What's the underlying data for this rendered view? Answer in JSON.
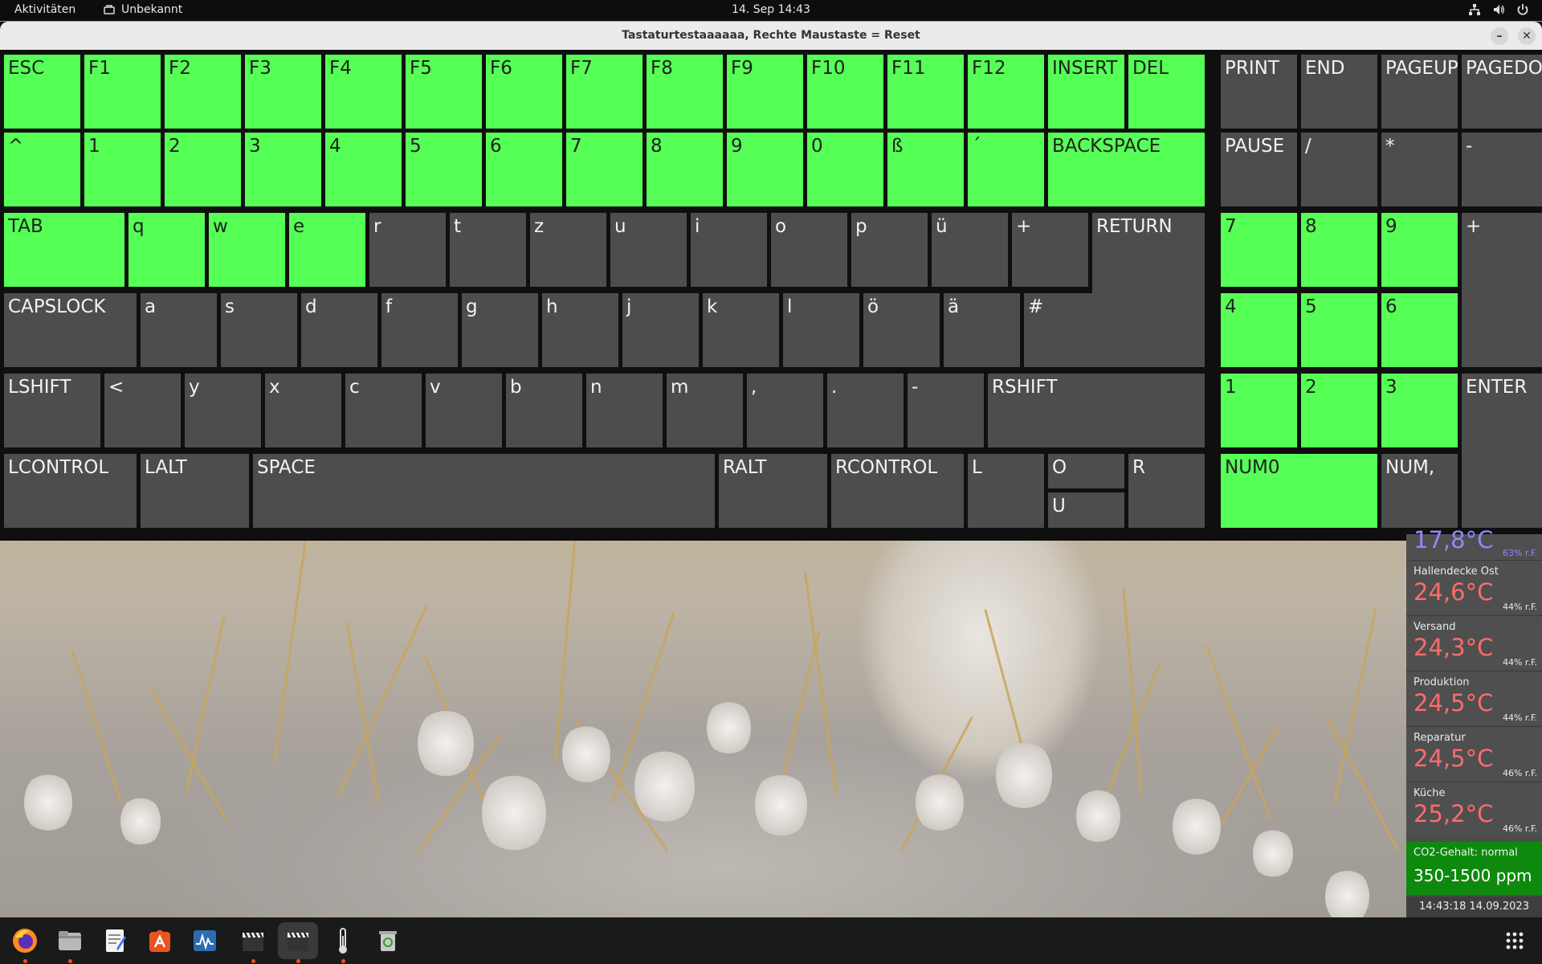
{
  "topbar": {
    "activities": "Aktivitäten",
    "app_name": "Unbekannt",
    "clock": "14. Sep  14:43"
  },
  "window": {
    "title": "Tastaturtestaaaaaa, Rechte Maustaste = Reset"
  },
  "colors": {
    "key_pressed": "#55ff55",
    "key_idle": "#4d4d4d",
    "temperature": "#ff6b6b",
    "co2_ok": "#0d8a0d"
  },
  "keys": {
    "esc": {
      "label": "ESC",
      "pressed": true
    },
    "f1": {
      "label": "F1",
      "pressed": true
    },
    "f2": {
      "label": "F2",
      "pressed": true
    },
    "f3": {
      "label": "F3",
      "pressed": true
    },
    "f4": {
      "label": "F4",
      "pressed": true
    },
    "f5": {
      "label": "F5",
      "pressed": true
    },
    "f6": {
      "label": "F6",
      "pressed": true
    },
    "f7": {
      "label": "F7",
      "pressed": true
    },
    "f8": {
      "label": "F8",
      "pressed": true
    },
    "f9": {
      "label": "F9",
      "pressed": true
    },
    "f10": {
      "label": "F10",
      "pressed": true
    },
    "f11": {
      "label": "F11",
      "pressed": true
    },
    "f12": {
      "label": "F12",
      "pressed": true
    },
    "insert": {
      "label": "INSERT",
      "pressed": true
    },
    "del": {
      "label": "DEL",
      "pressed": true
    },
    "print": {
      "label": "PRINT",
      "pressed": false
    },
    "end": {
      "label": "END",
      "pressed": false
    },
    "pageup": {
      "label": "PAGEUP",
      "pressed": false
    },
    "pagedown": {
      "label": "PAGEDOWN",
      "pressed": false
    },
    "caret": {
      "label": "^",
      "pressed": true
    },
    "d1": {
      "label": "1",
      "pressed": true
    },
    "d2": {
      "label": "2",
      "pressed": true
    },
    "d3": {
      "label": "3",
      "pressed": true
    },
    "d4": {
      "label": "4",
      "pressed": true
    },
    "d5": {
      "label": "5",
      "pressed": true
    },
    "d6": {
      "label": "6",
      "pressed": true
    },
    "d7": {
      "label": "7",
      "pressed": true
    },
    "d8": {
      "label": "8",
      "pressed": true
    },
    "d9": {
      "label": "9",
      "pressed": true
    },
    "d0": {
      "label": "0",
      "pressed": true
    },
    "sz": {
      "label": "ß",
      "pressed": true
    },
    "acute": {
      "label": "´",
      "pressed": true
    },
    "backspace": {
      "label": "BACKSPACE",
      "pressed": true
    },
    "pause": {
      "label": "PAUSE",
      "pressed": false
    },
    "kp_div": {
      "label": "/",
      "pressed": false
    },
    "kp_mul": {
      "label": "*",
      "pressed": false
    },
    "kp_sub": {
      "label": "-",
      "pressed": false
    },
    "tab": {
      "label": "TAB",
      "pressed": true
    },
    "q": {
      "label": "q",
      "pressed": true
    },
    "w": {
      "label": "w",
      "pressed": true
    },
    "e": {
      "label": "e",
      "pressed": true
    },
    "r": {
      "label": "r",
      "pressed": false
    },
    "t": {
      "label": "t",
      "pressed": false
    },
    "z": {
      "label": "z",
      "pressed": false
    },
    "u": {
      "label": "u",
      "pressed": false
    },
    "i": {
      "label": "i",
      "pressed": false
    },
    "o": {
      "label": "o",
      "pressed": false
    },
    "p": {
      "label": "p",
      "pressed": false
    },
    "ue": {
      "label": "ü",
      "pressed": false
    },
    "plus": {
      "label": "+",
      "pressed": false
    },
    "return": {
      "label": "RETURN",
      "pressed": false
    },
    "kp7": {
      "label": "7",
      "pressed": true
    },
    "kp8": {
      "label": "8",
      "pressed": true
    },
    "kp9": {
      "label": "9",
      "pressed": true
    },
    "kp_add": {
      "label": "+",
      "pressed": false
    },
    "capslock": {
      "label": "CAPSLOCK",
      "pressed": false
    },
    "a": {
      "label": "a",
      "pressed": false
    },
    "s": {
      "label": "s",
      "pressed": false
    },
    "d": {
      "label": "d",
      "pressed": false
    },
    "f": {
      "label": "f",
      "pressed": false
    },
    "g": {
      "label": "g",
      "pressed": false
    },
    "h": {
      "label": "h",
      "pressed": false
    },
    "j": {
      "label": "j",
      "pressed": false
    },
    "k": {
      "label": "k",
      "pressed": false
    },
    "l": {
      "label": "l",
      "pressed": false
    },
    "oe": {
      "label": "ö",
      "pressed": false
    },
    "ae": {
      "label": "ä",
      "pressed": false
    },
    "hash": {
      "label": "#",
      "pressed": false
    },
    "kp4": {
      "label": "4",
      "pressed": true
    },
    "kp5": {
      "label": "5",
      "pressed": true
    },
    "kp6": {
      "label": "6",
      "pressed": true
    },
    "lshift": {
      "label": "LSHIFT",
      "pressed": false
    },
    "less": {
      "label": "<",
      "pressed": false
    },
    "y": {
      "label": "y",
      "pressed": false
    },
    "x": {
      "label": "x",
      "pressed": false
    },
    "c": {
      "label": "c",
      "pressed": false
    },
    "v": {
      "label": "v",
      "pressed": false
    },
    "b": {
      "label": "b",
      "pressed": false
    },
    "n": {
      "label": "n",
      "pressed": false
    },
    "m": {
      "label": "m",
      "pressed": false
    },
    "comma": {
      "label": ",",
      "pressed": false
    },
    "period": {
      "label": ".",
      "pressed": false
    },
    "minus": {
      "label": "-",
      "pressed": false
    },
    "rshift": {
      "label": "RSHIFT",
      "pressed": false
    },
    "kp1": {
      "label": "1",
      "pressed": true
    },
    "kp2": {
      "label": "2",
      "pressed": true
    },
    "kp3": {
      "label": "3",
      "pressed": true
    },
    "enter": {
      "label": "ENTER",
      "pressed": false
    },
    "lcontrol": {
      "label": "LCONTROL",
      "pressed": false
    },
    "lalt": {
      "label": "LALT",
      "pressed": false
    },
    "space": {
      "label": "SPACE",
      "pressed": false
    },
    "ralt": {
      "label": "RALT",
      "pressed": false
    },
    "rcontrol": {
      "label": "RCONTROL",
      "pressed": false
    },
    "arrow_l": {
      "label": "L",
      "pressed": false
    },
    "arrow_o": {
      "label": "O",
      "pressed": false
    },
    "arrow_u": {
      "label": "U",
      "pressed": false
    },
    "arrow_r": {
      "label": "R",
      "pressed": false
    },
    "num0": {
      "label": "NUM0",
      "pressed": true
    },
    "num_comma": {
      "label": "NUM,",
      "pressed": false
    }
  },
  "sensors": {
    "partial": {
      "value": "17,8°C",
      "humidity": "63% r.F."
    },
    "hallendecke": {
      "name": "Hallendecke Ost",
      "value": "24,6°C",
      "humidity": "44% r.F."
    },
    "versand": {
      "name": "Versand",
      "value": "24,3°C",
      "humidity": "44% r.F."
    },
    "produktion": {
      "name": "Produktion",
      "value": "24,5°C",
      "humidity": "44% r.F."
    },
    "reparatur": {
      "name": "Reparatur",
      "value": "24,5°C",
      "humidity": "46% r.F."
    },
    "kueche": {
      "name": "Küche",
      "value": "25,2°C",
      "humidity": "46% r.F."
    }
  },
  "co2": {
    "label": "CO2-Gehalt: normal",
    "value": "350-1500 ppm"
  },
  "widget_clock": "14:43:18  14.09.2023",
  "dock": {
    "apps": [
      "firefox-icon",
      "files-icon",
      "text-editor-icon",
      "app-center-icon",
      "system-monitor-icon",
      "clapperboard-icon",
      "clapperboard-active-icon",
      "thermometer-icon",
      "trash-icon"
    ],
    "grid": "show-apps-icon"
  }
}
